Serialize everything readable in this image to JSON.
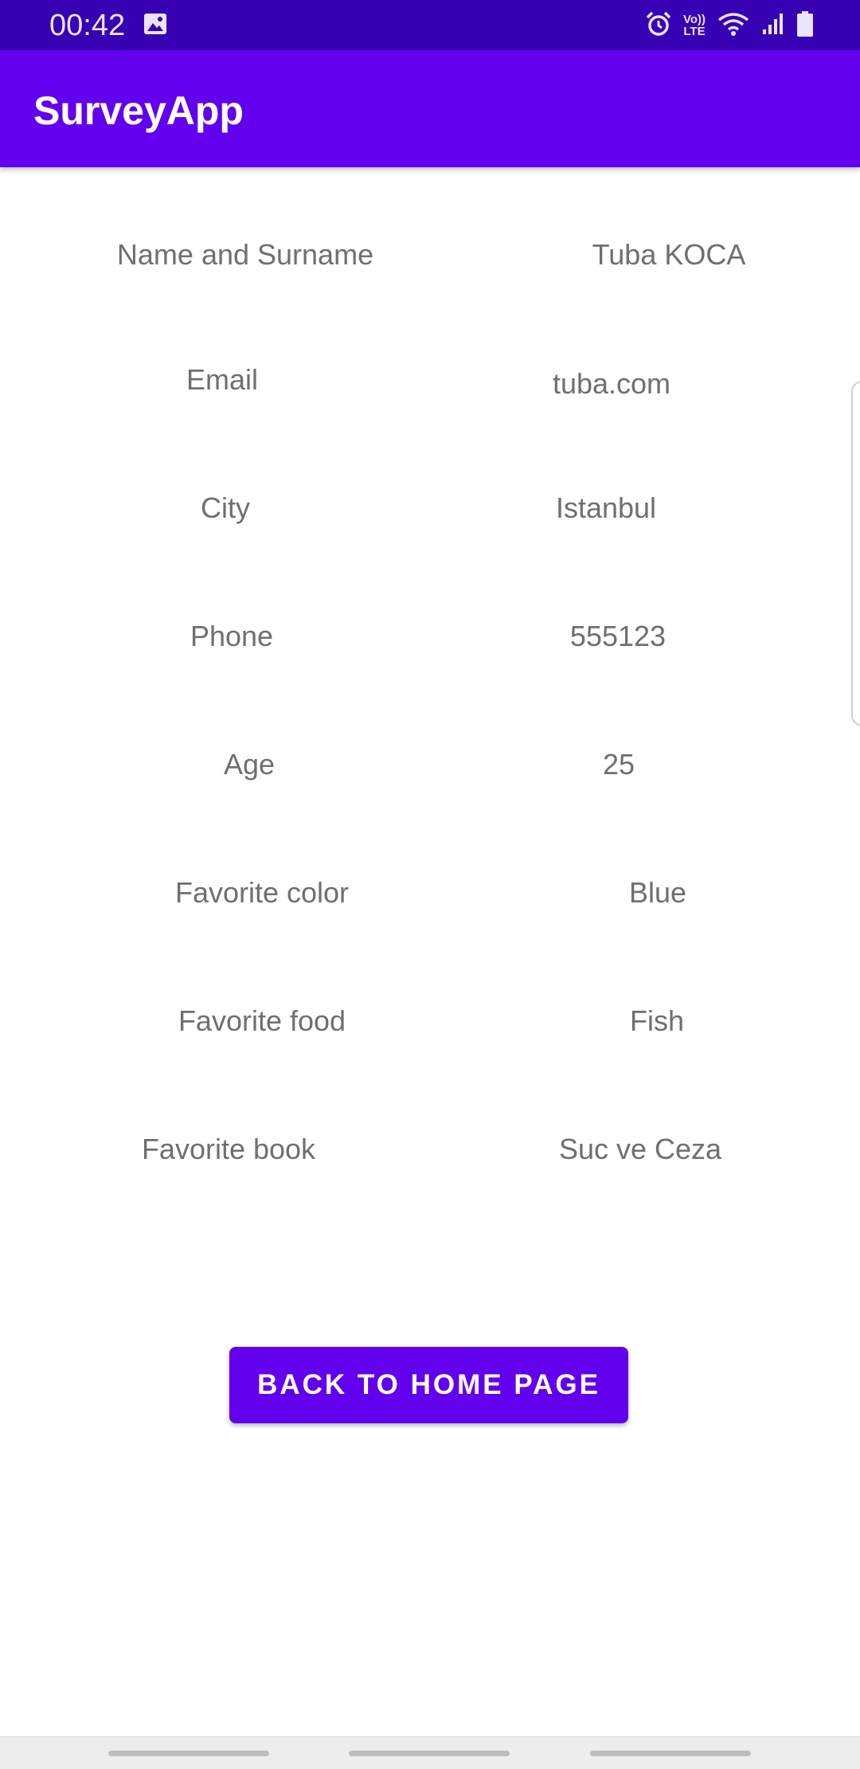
{
  "status_bar": {
    "time": "00:42",
    "icons": [
      "gallery-icon",
      "alarm-icon",
      "volte-icon",
      "wifi-icon",
      "signal-icon",
      "battery-icon"
    ],
    "volte_label_top": "Vo))",
    "volte_label_bottom": "LTE"
  },
  "app_bar": {
    "title": "SurveyApp"
  },
  "survey": {
    "rows": [
      {
        "label": "Name and Surname",
        "value": "Tuba KOCA"
      },
      {
        "label": "Email",
        "value": "tuba.com"
      },
      {
        "label": "City",
        "value": "Istanbul"
      },
      {
        "label": "Phone",
        "value": "555123"
      },
      {
        "label": "Age",
        "value": "25"
      },
      {
        "label": "Favorite color",
        "value": "Blue"
      },
      {
        "label": "Favorite food",
        "value": "Fish"
      },
      {
        "label": "Favorite book",
        "value": "Suc ve Ceza"
      }
    ]
  },
  "actions": {
    "back_label": "BACK TO HOME PAGE"
  },
  "colors": {
    "status_bar": "#3700b3",
    "primary": "#6200ee",
    "text_secondary": "#6f6f6f",
    "background": "#ffffff"
  }
}
